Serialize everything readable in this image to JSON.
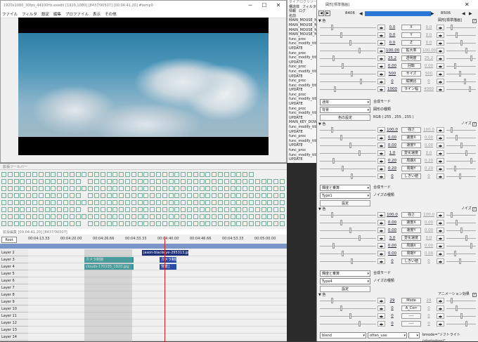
{
  "main_window": {
    "title": "1920x1080_30fps_44100Hz.exedit [1920,1080]  [8437/90507] [00:04:41.20]  #temp0",
    "menu": [
      "ファイル",
      "フィルタ",
      "設定",
      "編集",
      "プロファイル",
      "表示",
      "その他"
    ],
    "controls": {
      "min": "─",
      "max": "☐",
      "close": "✕"
    }
  },
  "side_panel": {
    "title": "ダイアログリソース",
    "tabs": [
      "構造体",
      "フィルタ"
    ],
    "tab2": [
      "情報",
      "ログ"
    ],
    "items": [
      "名前",
      "MAIN_MOUSE_MOVE",
      "MAIN_MOUSE_MOVE",
      "MAIN_MOUSE_MOVE",
      "MAIN_MOUSE_MOVE",
      "func_proc",
      "func_modify_title",
      "UPDATE",
      "func_proc",
      "func_modify_title",
      "UPDATE",
      "func_proc",
      "func_modify_title",
      "UPDATE",
      "func_proc",
      "func_modify_title",
      "UPDATE",
      "func_proc",
      "func_modify_title",
      "UPDATE",
      "func_proc",
      "func_modify_title",
      "UPDATE",
      "MAIN_KEY_DOWN",
      "func_modify_title",
      "UPDATE",
      "func_proc",
      "func_modify_title",
      "UPDATE",
      "func_proc",
      "func_modify_title",
      "UPDATE"
    ]
  },
  "dialog": {
    "title": "図形[標準描画]",
    "frame_start": "8406",
    "frame_end": "8506",
    "header_label": "図形[標準描画]",
    "sections": [
      {
        "name": "色",
        "params": [
          {
            "v1": "0.0",
            "label": "X",
            "v2": "0.0"
          },
          {
            "v1": "0.0",
            "label": "Y",
            "v2": "0.0"
          },
          {
            "v1": "0.0",
            "label": "Z",
            "v2": "0.0"
          },
          {
            "v1": "100.00",
            "label": "拡大率",
            "v2": "100.00"
          },
          {
            "v1": "25.2",
            "label": "透明度",
            "v2": "25.2"
          },
          {
            "v1": "0.00",
            "label": "回転",
            "v2": "0.00"
          },
          {
            "v1": "500",
            "label": "サイズ",
            "v2": "500"
          },
          {
            "v1": "0",
            "label": "縦横比",
            "v2": "0"
          },
          {
            "v1": "1000",
            "label": "ライン幅",
            "v2": "4000"
          }
        ]
      }
    ],
    "blend_mode": "通常",
    "blend_label": "合成モード",
    "shape_select": "背景",
    "shape_label": "図形の種類",
    "color_button": "色の設定",
    "rgb_text": "RGB ( 255 , 255 , 255 )",
    "noise1": {
      "section": "色",
      "tag": "ノイズ",
      "params": [
        {
          "v1": "100.0",
          "label": "強さ",
          "v2": "100.0"
        },
        {
          "v1": "0.00",
          "label": "速度X",
          "v2": "0.00"
        },
        {
          "v1": "0.00",
          "label": "速度Y",
          "v2": "0.00"
        },
        {
          "v1": "1.0",
          "label": "変化速度",
          "v2": "0.0"
        },
        {
          "v1": "0.20",
          "label": "周期X",
          "v2": "0.20"
        },
        {
          "v1": "0.20",
          "label": "周期Y",
          "v2": "0.20"
        },
        {
          "v1": "0",
          "label": "しきい値",
          "v2": "0"
        }
      ],
      "blend": "輝度と乗算",
      "blend_label": "合成モード",
      "type": "Type1",
      "type_label": "ノイズの種類",
      "setting": "設定"
    },
    "noise2": {
      "section": "色",
      "tag": "ノイズ",
      "params": [
        {
          "v1": "100.0",
          "label": "強さ",
          "v2": "100.0"
        },
        {
          "v1": "0.00",
          "label": "速度X",
          "v2": "0.00"
        },
        {
          "v1": "0.00",
          "label": "速度Y",
          "v2": "0.00"
        },
        {
          "v1": "3.0",
          "label": "変化速度",
          "v2": "0.0"
        },
        {
          "v1": "0.00",
          "label": "周期X",
          "v2": "0.00"
        },
        {
          "v1": "0.00",
          "label": "周期Y",
          "v2": "0.00"
        },
        {
          "v1": "0",
          "label": "しきい値",
          "v2": "0"
        }
      ],
      "blend": "輝度と乗算",
      "blend_label": "合成モード",
      "type": "Type4",
      "type_label": "ノイズの種類",
      "setting": "設定"
    },
    "anim": {
      "section": "色",
      "tag": "アニメーション効果",
      "params": [
        {
          "v1": "29",
          "label": "Mode",
          "v2": "29"
        },
        {
          "v1": "0",
          "label": "A_Corr",
          "v2": "0"
        },
        {
          "v1": "0",
          "label": "----",
          "v2": "0"
        },
        {
          "v1": "0",
          "label": "----",
          "v2": "0"
        }
      ],
      "select1": "blend",
      "select2": "often_use",
      "select3": "",
      "text": "bmode=\"ソフトライト(photoshop)\""
    }
  },
  "timeline": {
    "title": "拡張編集  [00:04:41.20] [8437/90507]",
    "root_label": "Root",
    "ticks": [
      "00:04:13.33",
      "00:04:20.00",
      "00:04:26.66",
      "00:04:33.33",
      "00:04:40.00",
      "00:04:46.66",
      "00:04:53.33",
      "00:05:00.00"
    ],
    "layers": [
      "Layer 2",
      "Layer 3",
      "Layer 4",
      "Layer 5",
      "Layer 6",
      "Layer 7",
      "Layer 8",
      "Layer 9",
      "Layer 10",
      "Layer 11",
      "Layer 12",
      "Layer 13",
      "Layer 14"
    ],
    "clips": {
      "layer2": "jason-blackeye-295313.jpg",
      "layer3a": "カメラ制御",
      "layer3b": "カメラ制御",
      "layer4a": "clouds-170135_1920.jpg",
      "layer4b": "背景]"
    }
  },
  "toolbar_label": "拡張ツールバー",
  "colors": {
    "clip_teal": "#1a9a9a",
    "clip_blue": "#2a4aa8",
    "clip_navy": "#1e2f7a",
    "accent": "#2a77d6",
    "cursor": "#e02020"
  }
}
